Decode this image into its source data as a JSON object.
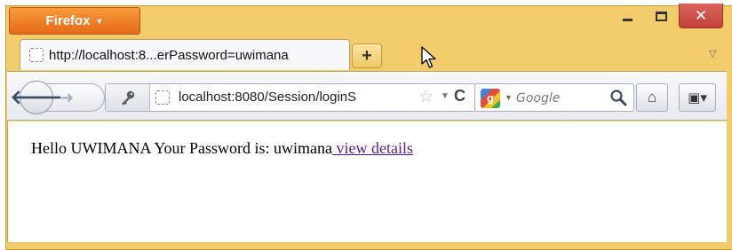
{
  "app": {
    "menu_button_label": "Firefox",
    "menu_chevron": "▼"
  },
  "window_controls": {
    "close_glyph": "✕"
  },
  "tab": {
    "title": "http://localhost:8...erPassword=uwimana"
  },
  "new_tab_glyph": "+",
  "tab_list_glyph": "▽",
  "toolbar": {
    "back_glyph": "🡐",
    "forward_glyph": "➜",
    "identity_icon": "key-icon",
    "url": "localhost:8080/Session/loginS",
    "bookmark_star": "☆",
    "url_dropdown": "▼",
    "reload_glyph": "C",
    "home_glyph": "⌂",
    "bookmarks_glyph": "▣▾"
  },
  "search": {
    "engine_letter": "g",
    "engine_dropdown": "▼",
    "placeholder": "Google"
  },
  "page": {
    "message": "Hello UWIMANA Your Password is: uwimana",
    "link_text": " view details",
    "link_color": "#551a8b"
  },
  "colors": {
    "frame": "#f2cc6b",
    "app_button": "#e87a26",
    "close_button": "#c94b42"
  }
}
